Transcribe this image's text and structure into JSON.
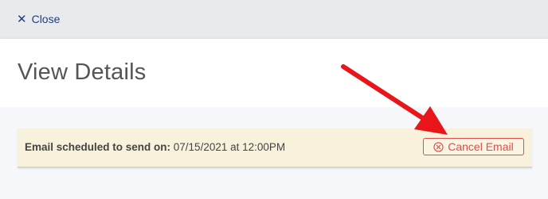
{
  "topbar": {
    "close_label": "Close",
    "close_icon": "close-icon"
  },
  "header": {
    "title": "View Details"
  },
  "notice": {
    "label": "Email scheduled to send on:",
    "value": " 07/15/2021 at 12:00PM",
    "cancel_label": "Cancel Email",
    "cancel_icon": "circle-x-icon"
  },
  "colors": {
    "accent_blue": "#1f3f7a",
    "danger": "#e04b4b",
    "notice_bg": "#f8f2dc",
    "annotation_arrow": "#e8151b"
  }
}
